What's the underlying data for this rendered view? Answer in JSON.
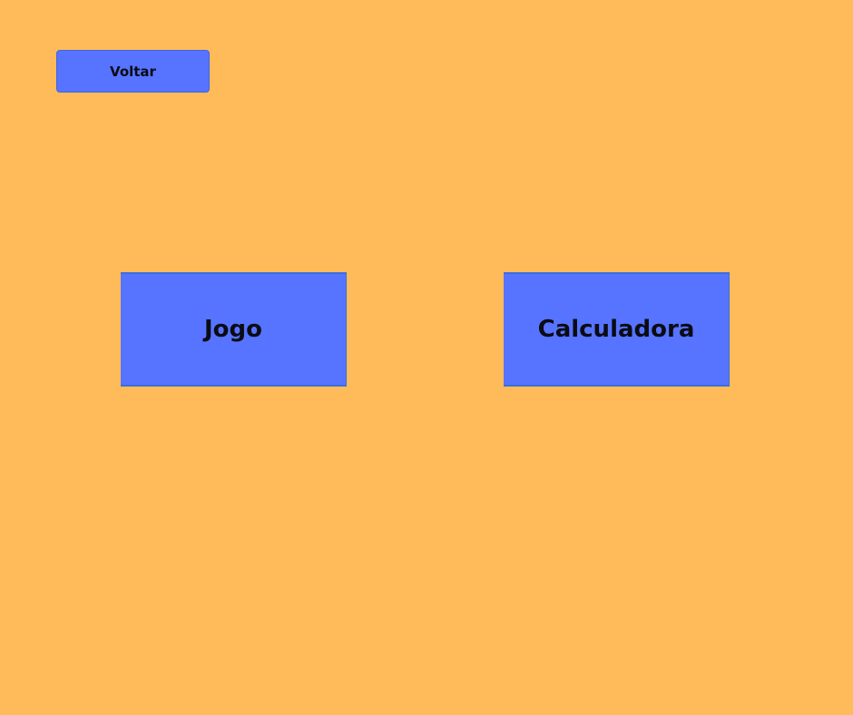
{
  "theme": {
    "background_color": "#FFBB59",
    "button_color": "#5674FF",
    "text_color": "#0B0B14"
  },
  "nav": {
    "back_label": "Voltar"
  },
  "menu": {
    "items": [
      {
        "label": "Jogo"
      },
      {
        "label": "Calculadora"
      }
    ]
  }
}
